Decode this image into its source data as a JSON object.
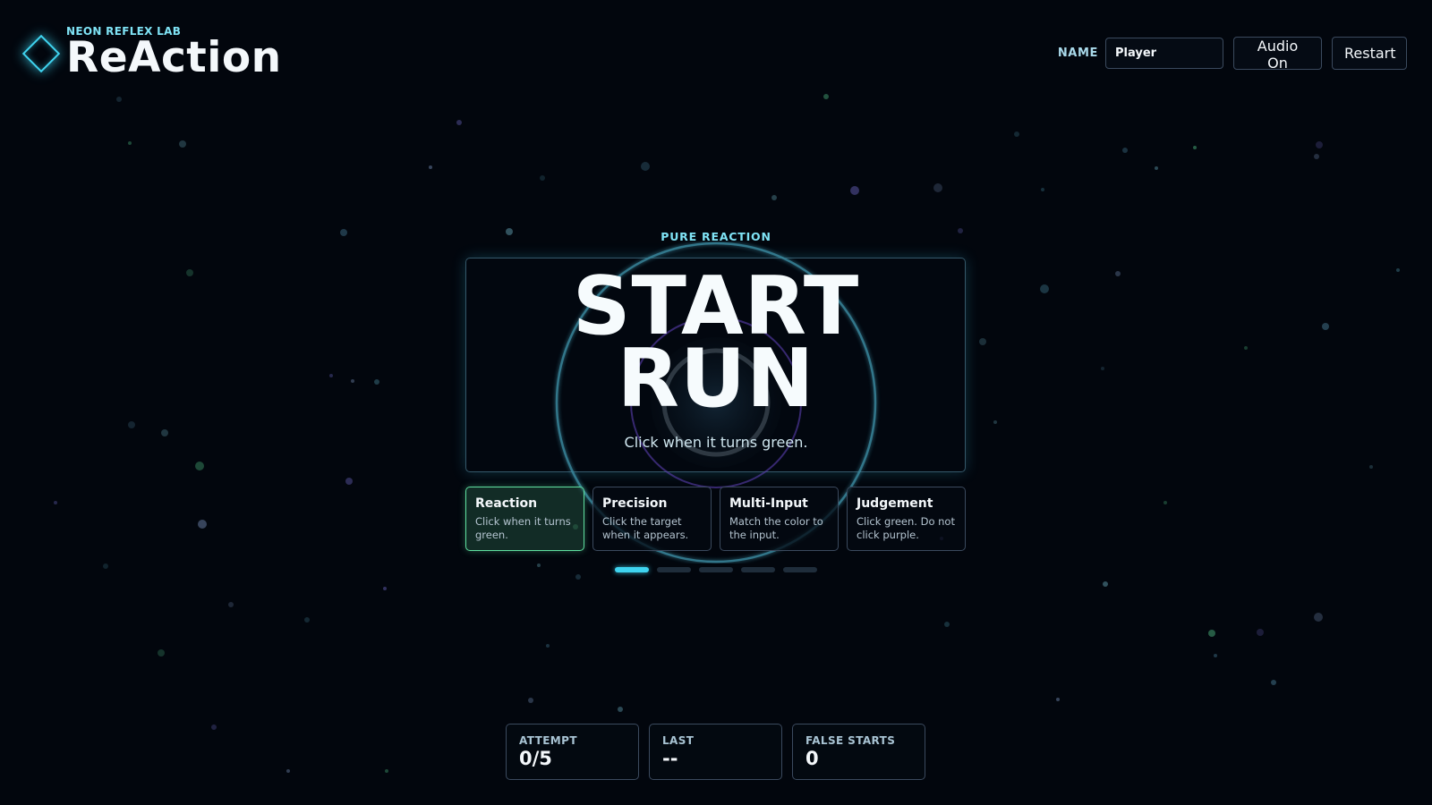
{
  "header": {
    "kicker": "NEON REFLEX LAB",
    "title": "ReAction",
    "logo_icon": "diamond-icon",
    "name_label": "NAME",
    "name_value": "Player",
    "audio_button": "Audio On",
    "restart_button": "Restart"
  },
  "game": {
    "mode_kicker": "PURE REACTION",
    "start_line1": "START",
    "start_line2": "RUN",
    "subtitle": "Click when it turns green.",
    "modes": [
      {
        "name": "Reaction",
        "desc": "Click when it turns green.",
        "active": true
      },
      {
        "name": "Precision",
        "desc": "Click the target when it appears.",
        "active": false
      },
      {
        "name": "Multi-Input",
        "desc": "Match the color to the input.",
        "active": false
      },
      {
        "name": "Judgement",
        "desc": "Click green. Do not click purple.",
        "active": false
      }
    ],
    "page_indicator": {
      "count": 5,
      "active_index": 0
    }
  },
  "stats": {
    "attempt_label": "ATTEMPT",
    "attempt_value": "0/5",
    "last_label": "LAST",
    "last_value": "--",
    "false_starts_label": "FALSE STARTS",
    "false_starts_value": "0"
  },
  "colors": {
    "background": "#02060d",
    "accent_cyan": "#3fd4f0",
    "active_green": "#5fe0a0",
    "ring_purple": "#5b3fb0"
  }
}
